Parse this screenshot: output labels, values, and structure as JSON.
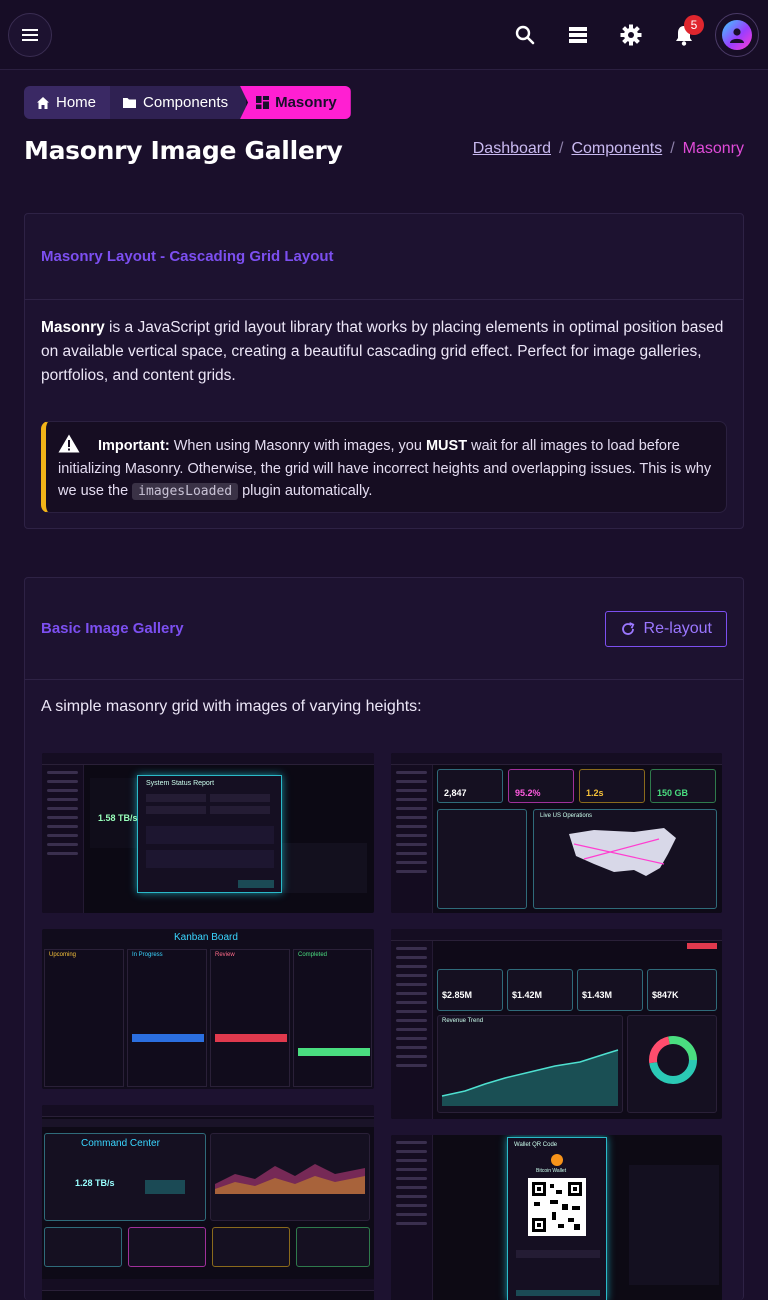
{
  "topbar": {
    "notification_count": "5"
  },
  "breadcrumb": {
    "home": "Home",
    "components": "Components",
    "current": "Masonry"
  },
  "page": {
    "title": "Masonry Image Gallery",
    "right_breadcrumb": {
      "dashboard": "Dashboard",
      "components": "Components",
      "current": "Masonry",
      "sep": "/"
    }
  },
  "intro_card": {
    "title": "Masonry Layout - Cascading Grid Layout",
    "lead_bold": "Masonry",
    "lead_text": " is a JavaScript grid layout library that works by placing elements in optimal position based on available vertical space, creating a beautiful cascading grid effect. Perfect for image galleries, portfolios, and content grids.",
    "alert": {
      "label": "Important:",
      "text1": " When using Masonry with images, you ",
      "must": "MUST",
      "text2": " wait for all images to load before initializing Masonry. Otherwise, the grid will have incorrect heights and overlapping issues. This is why we use the ",
      "code": "imagesLoaded",
      "text3": " plugin automatically."
    }
  },
  "gallery_card": {
    "title": "Basic Image Gallery",
    "relayout_label": "Re-layout",
    "description": "A simple masonry grid with images of varying heights:",
    "images": [
      {
        "caption": "System Status Report",
        "stat": "1.58 TB/s"
      },
      {
        "caption": "Live US Operations",
        "stat1": "2,847",
        "stat2": "95.2%",
        "stat3": "1.2s",
        "stat4": "150 GB"
      },
      {
        "caption": "Kanban Board",
        "cols": [
          "Upcoming",
          "In Progress",
          "Review",
          "Completed"
        ]
      },
      {
        "caption": "Revenue Trend",
        "stat1": "$2.85M",
        "stat2": "$1.42M",
        "stat3": "$1.43M",
        "stat4": "$847K"
      },
      {
        "caption": "Command Center",
        "stat": "1.28 TB/s"
      },
      {
        "caption": "Wallet QR Code",
        "stat": "Bitcoin Wallet"
      }
    ]
  },
  "colors": {
    "accent": "#7c4ff0",
    "pink": "#ff1fd2",
    "warning": "#f2b418",
    "background": "#1a0f2b"
  }
}
